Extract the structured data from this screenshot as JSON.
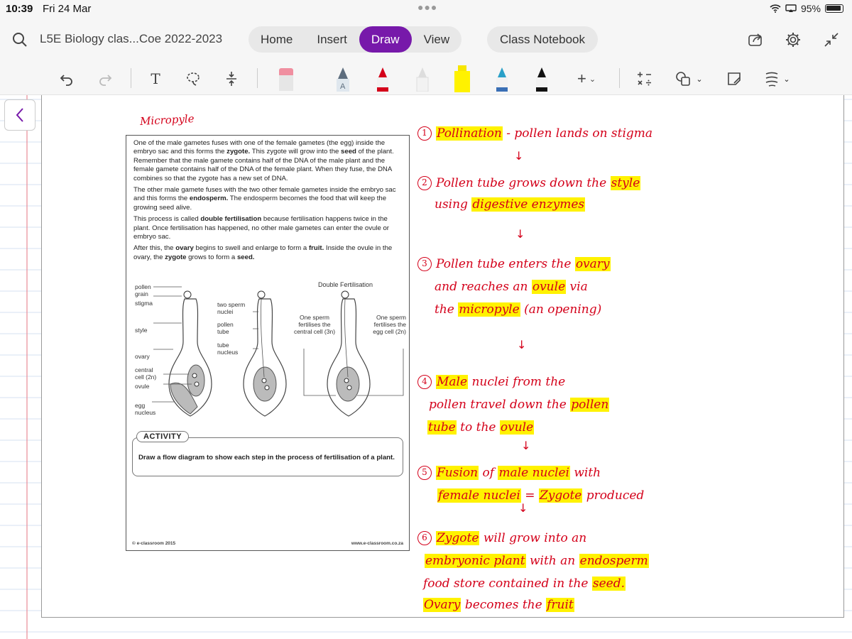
{
  "status_bar": {
    "time": "10:39",
    "date": "Fri 24 Mar",
    "battery": "95%"
  },
  "header": {
    "notebook_title": "L5E Biology clas...Coe 2022-2023",
    "tabs": [
      "Home",
      "Insert",
      "Draw",
      "View"
    ],
    "active_tab": "Draw",
    "class_notebook": "Class Notebook"
  },
  "toolbar": {
    "text_tool": "T",
    "pen_letter": "A"
  },
  "worksheet": {
    "handwritten_heading": "Micropyle",
    "paragraphs": [
      [
        {
          "t": "One of the male gametes fuses with one of the female gametes (the egg) inside the embryo sac and this forms the "
        },
        {
          "t": "zygote.",
          "b": 1
        },
        {
          "t": " This zygote will grow into the "
        },
        {
          "t": "seed",
          "b": 1
        },
        {
          "t": " of the plant. Remember that the male gamete contains half of the DNA of the male plant and the female gamete contains half of the DNA of the female plant. When they fuse, the DNA combines so that the zygote has a new set of DNA."
        }
      ],
      [
        {
          "t": "The other male gamete fuses with the two other female gametes inside the embryo sac and this forms the "
        },
        {
          "t": "endosperm.",
          "b": 1
        },
        {
          "t": " The endosperm becomes the food that will keep the growing seed alive."
        }
      ],
      [
        {
          "t": "This process is called "
        },
        {
          "t": "double fertilisation",
          "b": 1
        },
        {
          "t": " because fertilisation happens twice in the plant. Once fertilisation has happened, no other male gametes can enter the ovule or embryo sac."
        }
      ],
      [
        {
          "t": "After this, the "
        },
        {
          "t": "ovary",
          "b": 1
        },
        {
          "t": " begins to swell and enlarge to form a "
        },
        {
          "t": "fruit.",
          "b": 1
        },
        {
          "t": " Inside the ovule in the ovary, the "
        },
        {
          "t": "zygote",
          "b": 1
        },
        {
          "t": " grows to form a "
        },
        {
          "t": "seed.",
          "b": 1
        }
      ]
    ],
    "diagram": {
      "title": "Double Fertilisation",
      "labels": {
        "pollen_grain": "pollen grain",
        "stigma": "stigma",
        "style": "style",
        "ovary": "ovary",
        "central_cell": "central cell (2n)",
        "ovule": "ovule",
        "egg_nucleus": "egg nucleus",
        "two_sperm": "two sperm nuclei",
        "pollen_tube": "pollen tube",
        "tube_nucleus": "tube nucleus",
        "sperm_central": "One sperm fertilises the central cell (3n)",
        "sperm_egg": "One sperm fertilises the egg cell (2n)"
      }
    },
    "activity_tag": "ACTIVITY",
    "activity_text": "Draw a flow diagram to show each step in the process of fertilisation of a plant.",
    "footer_left": "© e-classroom 2015",
    "footer_right": "www.e-classroom.co.za"
  },
  "notes": [
    {
      "step": "1",
      "lines": [
        [
          {
            "t": "Pollination",
            "hl": 1
          },
          {
            "t": " - pollen lands on stigma"
          }
        ]
      ]
    },
    {
      "step": "2",
      "lines": [
        [
          {
            "t": "Pollen tube grows down the "
          },
          {
            "t": "style",
            "hl": 1
          }
        ],
        [
          {
            "t": "using "
          },
          {
            "t": "digestive enzymes",
            "hl": 1
          }
        ]
      ]
    },
    {
      "step": "3",
      "lines": [
        [
          {
            "t": "Pollen tube enters the "
          },
          {
            "t": "ovary",
            "hl": 1
          }
        ],
        [
          {
            "t": "and reaches an "
          },
          {
            "t": "ovule",
            "hl": 1
          },
          {
            "t": " via"
          }
        ],
        [
          {
            "t": "the "
          },
          {
            "t": "micropyle",
            "hl": 1
          },
          {
            "t": " (an opening)"
          }
        ]
      ]
    },
    {
      "step": "4",
      "lines": [
        [
          {
            "t": "Male",
            "hl": 1
          },
          {
            "t": " nuclei from the"
          }
        ],
        [
          {
            "t": "pollen travel down the "
          },
          {
            "t": "pollen",
            "hl": 1
          }
        ],
        [
          {
            "t": "tube",
            "hl": 1
          },
          {
            "t": " to the "
          },
          {
            "t": "ovule",
            "hl": 1
          }
        ]
      ]
    },
    {
      "step": "5",
      "lines": [
        [
          {
            "t": "Fusion",
            "hl": 1
          },
          {
            "t": " of "
          },
          {
            "t": "male nuclei",
            "hl": 1
          },
          {
            "t": " with"
          }
        ],
        [
          {
            "t": "female nuclei",
            "hl": 1
          },
          {
            "t": " = "
          },
          {
            "t": "Zygote",
            "hl": 1
          },
          {
            "t": " produced"
          }
        ]
      ]
    },
    {
      "step": "6",
      "lines": [
        [
          {
            "t": "Zygote",
            "hl": 1
          },
          {
            "t": " will grow into an"
          }
        ],
        [
          {
            "t": "embryonic plant",
            "hl": 1
          },
          {
            "t": " with an "
          },
          {
            "t": "endosperm",
            "hl": 1
          }
        ],
        [
          {
            "t": "food store contained in the "
          },
          {
            "t": "seed.",
            "hl": 1
          }
        ],
        [
          {
            "t": "Ovary",
            "hl": 1
          },
          {
            "t": " becomes the "
          },
          {
            "t": "fruit",
            "hl": 1
          }
        ]
      ]
    }
  ],
  "arrow_glyph": "↓",
  "colors": {
    "accent": "#7719aa",
    "ink": "#d4001a",
    "highlight": "#fff200"
  }
}
